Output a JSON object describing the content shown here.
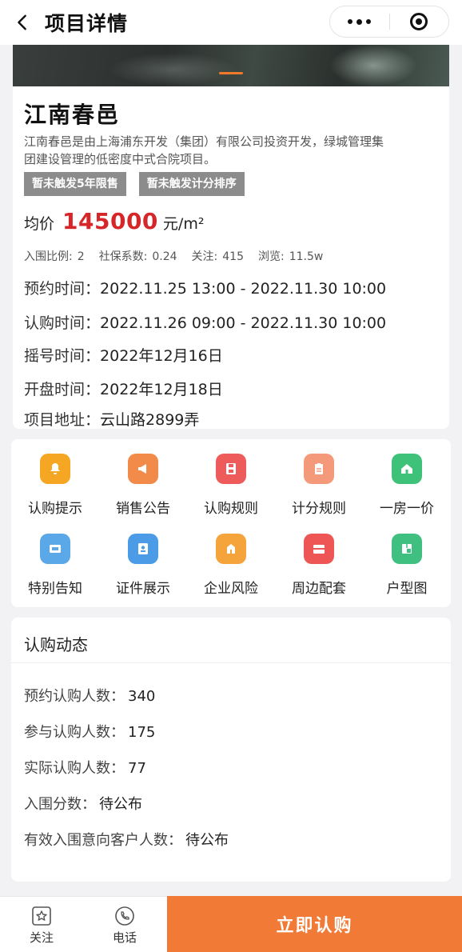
{
  "header": {
    "title": "项目详情"
  },
  "project": {
    "name": "江南春邑",
    "description": "江南春邑是由上海浦东开发（集团）有限公司投资开发，绿城管理集团建设管理的低密度中式合院项目。",
    "tags": [
      "暂未触发5年限售",
      "暂未触发计分排序"
    ],
    "price_label": "均价",
    "price_value": "145000",
    "price_unit": "元/m²",
    "stats": [
      {
        "label": "入围比例:",
        "value": "2"
      },
      {
        "label": "社保系数:",
        "value": "0.24"
      },
      {
        "label": "关注:",
        "value": "415"
      },
      {
        "label": "浏览:",
        "value": "11.5w"
      }
    ],
    "details": [
      {
        "label": "预约时间：",
        "value": "2022.11.25 13:00 - 2022.11.30 10:00"
      },
      {
        "label": "认购时间：",
        "value": "2022.11.26 09:00 - 2022.11.30 10:00"
      },
      {
        "label": "摇号时间：",
        "value": "2022年12月16日"
      },
      {
        "label": "开盘时间：",
        "value": "2022年12月18日"
      },
      {
        "label": "项目地址：",
        "value": "云山路2899弄"
      }
    ]
  },
  "grid": [
    {
      "label": "认购提示",
      "icon": "bell-icon",
      "color": "#f5a623"
    },
    {
      "label": "销售公告",
      "icon": "megaphone-icon",
      "color": "#f28a4a"
    },
    {
      "label": "认购规则",
      "icon": "save-icon",
      "color": "#ee5b5b"
    },
    {
      "label": "计分规则",
      "icon": "clipboard-icon",
      "color": "#f49a7a"
    },
    {
      "label": "一房一价",
      "icon": "home-icon",
      "color": "#3ec27a"
    },
    {
      "label": "特别告知",
      "icon": "notice-icon",
      "color": "#5aa8e8"
    },
    {
      "label": "证件展示",
      "icon": "id-card-icon",
      "color": "#4b9be6"
    },
    {
      "label": "企业风险",
      "icon": "building-icon",
      "color": "#f4a43a"
    },
    {
      "label": "周边配套",
      "icon": "store-icon",
      "color": "#ee5656"
    },
    {
      "label": "户型图",
      "icon": "floorplan-icon",
      "color": "#3fbf80"
    }
  ],
  "dynamics": {
    "title": "认购动态",
    "rows": [
      {
        "label": "预约认购人数：",
        "value": "340"
      },
      {
        "label": "参与认购人数：",
        "value": "175"
      },
      {
        "label": "实际认购人数：",
        "value": "77"
      },
      {
        "label": "入围分数：",
        "value": "待公布"
      },
      {
        "label": "有效入围意向客户人数：",
        "value": "待公布"
      }
    ]
  },
  "bottom": {
    "follow_label": "关注",
    "phone_label": "电话",
    "buy_label": "立即认购"
  }
}
